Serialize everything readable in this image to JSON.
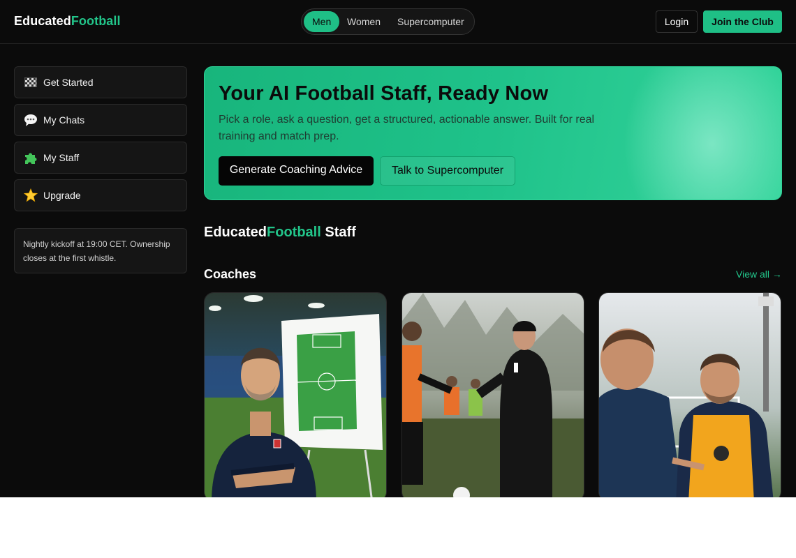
{
  "header": {
    "logo_part1": "Educated",
    "logo_part2": "Football",
    "tabs": [
      {
        "label": "Men",
        "active": true
      },
      {
        "label": "Women",
        "active": false
      },
      {
        "label": "Supercomputer",
        "active": false
      }
    ],
    "login_label": "Login",
    "join_label": "Join the Club"
  },
  "sidebar": {
    "items": [
      {
        "label": "Get Started",
        "icon": "checkered-flag-icon"
      },
      {
        "label": "My Chats",
        "icon": "speech-bubble-icon"
      },
      {
        "label": "My Staff",
        "icon": "puzzle-piece-icon"
      },
      {
        "label": "Upgrade",
        "icon": "star-icon"
      }
    ],
    "notice": "Nightly kickoff at 19:00 CET. Ownership closes at the first whistle."
  },
  "hero": {
    "title": "Your AI Football Staff, Ready Now",
    "subtitle": "Pick a role, ask a question, get a structured, actionable answer. Built for real training and match prep.",
    "primary_button": "Generate Coaching Advice",
    "secondary_button": "Talk to Supercomputer"
  },
  "staff": {
    "title_part1": "Educated",
    "title_part2": "Football",
    "title_part3": " Staff",
    "section_title": "Coaches",
    "view_all": "View all →",
    "cards": [
      {
        "image": "coach-with-tactics-board-photo"
      },
      {
        "image": "coach-at-training-session-photo"
      },
      {
        "image": "coach-talking-to-player-photo"
      }
    ]
  },
  "colors": {
    "accent": "#1fbf86",
    "background": "#0b0b0b",
    "panel": "#151515"
  }
}
